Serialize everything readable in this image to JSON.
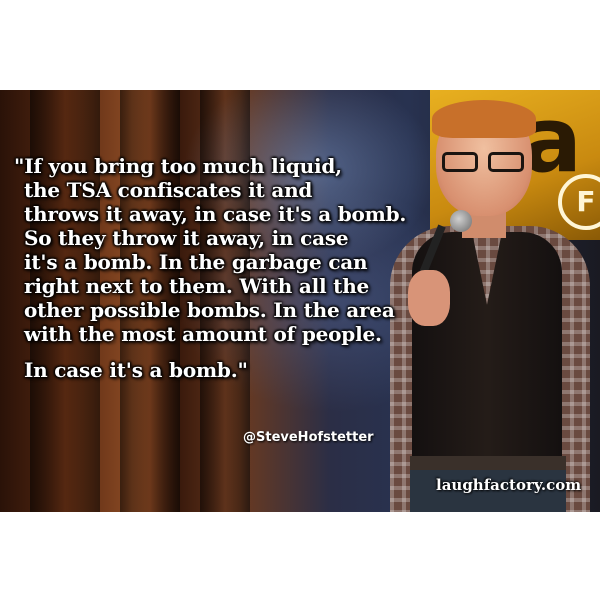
{
  "quote": {
    "lines": [
      "\"If you bring too much liquid,",
      "the TSA confiscates it and",
      "throws it away, in case it's a bomb.",
      "So they throw it away, in case",
      "it's a bomb. In the garbage can",
      "right next to them. With all the",
      "other possible bombs. In the area",
      "with the most amount of people.",
      "In case it's a bomb.\""
    ],
    "handle": "@SteveHofstetter"
  },
  "watermark": "laughfactory.com",
  "sign": {
    "letter": "a",
    "badge": "F"
  },
  "colors": {
    "text": "#ffffff",
    "sign": "#e8b020",
    "background": "#ffffff"
  }
}
